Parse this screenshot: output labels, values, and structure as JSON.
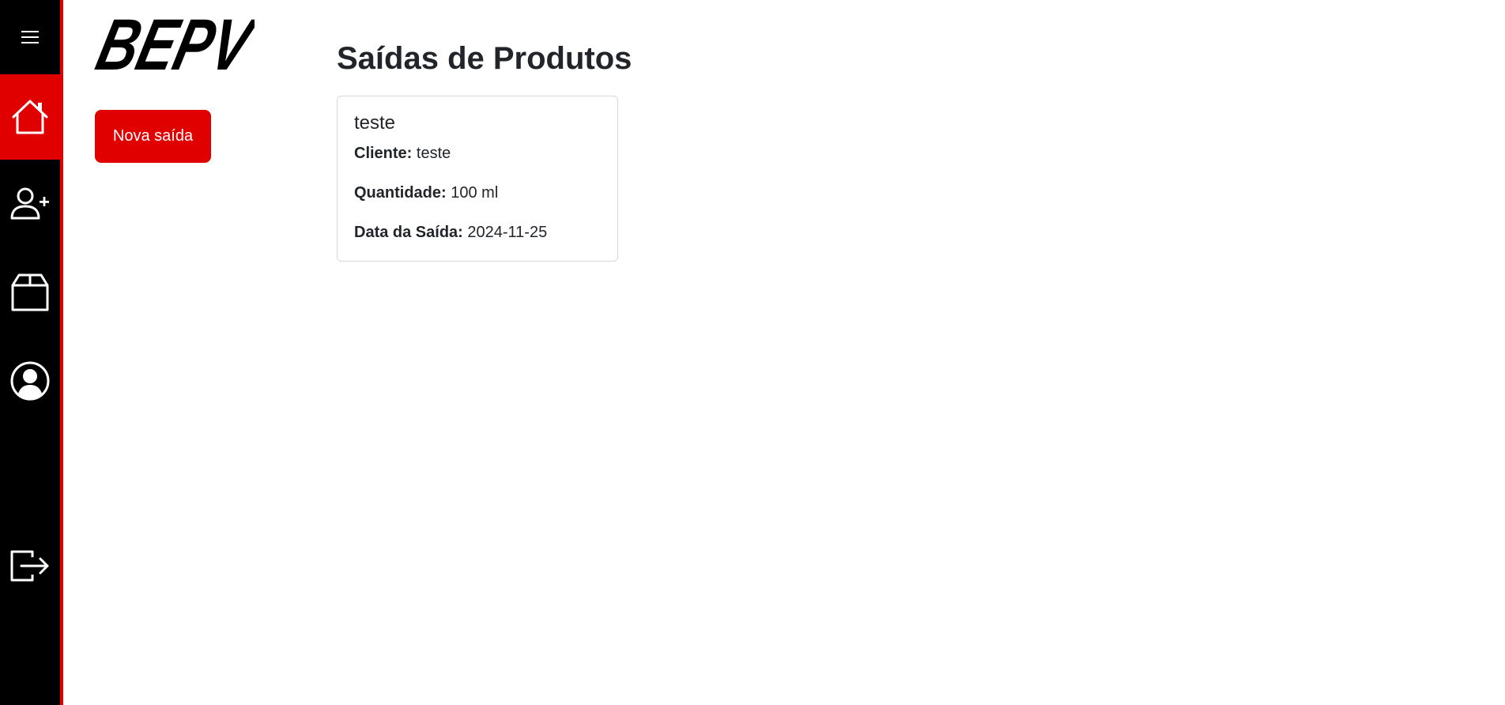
{
  "brand": {
    "logo_text": "BEPV"
  },
  "sidebar": {
    "items": [
      {
        "icon": "menu-icon"
      },
      {
        "icon": "home-icon",
        "active": true
      },
      {
        "icon": "user-add-icon"
      },
      {
        "icon": "box-icon"
      },
      {
        "icon": "profile-icon"
      },
      {
        "icon": "logout-icon"
      }
    ],
    "accent_color": "#e10000",
    "background_color": "#000000"
  },
  "actions": {
    "new_label": "Nova saída"
  },
  "main": {
    "title": "Saídas de Produtos",
    "cards": [
      {
        "title": "teste",
        "client_label": "Cliente:",
        "client_value": "teste",
        "quantity_label": "Quantidade:",
        "quantity_value": "100 ml",
        "date_label": "Data da Saída:",
        "date_value": "2024-11-25"
      }
    ]
  }
}
